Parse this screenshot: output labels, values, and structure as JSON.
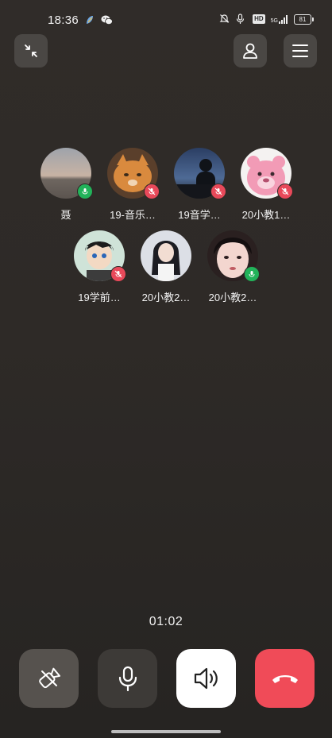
{
  "status_bar": {
    "time": "18:36",
    "network": "5G",
    "hd": "HD",
    "battery": "81",
    "icons": [
      "feather-app-icon",
      "wechat-icon",
      "alarm-off-icon",
      "mic-indicator-icon",
      "hd-icon",
      "signal-icon",
      "battery-icon"
    ]
  },
  "top_bar": {
    "minimize_icon": "minimize-arrows-icon",
    "contacts_icon": "person-icon",
    "menu_icon": "hamburger-menu-icon"
  },
  "participants": [
    {
      "name": "聂",
      "mic": "on",
      "avatar": "sky-dusk"
    },
    {
      "name": "19-音乐…",
      "mic": "off",
      "avatar": "cat"
    },
    {
      "name": "19音学…",
      "mic": "off",
      "avatar": "night-silhouette"
    },
    {
      "name": "20小教1…",
      "mic": "off",
      "avatar": "pink-bear"
    },
    {
      "name": "19学前…",
      "mic": "off",
      "avatar": "cartoon-boy"
    },
    {
      "name": "20小教2…",
      "mic": "none",
      "avatar": "girl-dark-hair"
    },
    {
      "name": "20小教2…",
      "mic": "on",
      "avatar": "girl-closeup"
    }
  ],
  "call": {
    "duration": "01:02"
  },
  "controls": {
    "camera_icon": "camera-off-icon",
    "mic_icon": "microphone-icon",
    "speaker_icon": "speaker-icon",
    "hangup_icon": "hang-up-icon"
  },
  "colors": {
    "background": "#2c2927",
    "mic_on": "#22b35a",
    "mic_off": "#e8495a",
    "hangup": "#f04b58"
  }
}
